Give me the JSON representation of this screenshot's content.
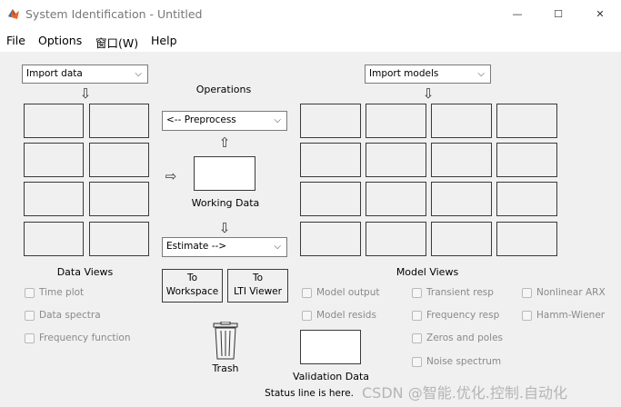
{
  "window": {
    "title": "System Identification - Untitled",
    "controls": {
      "minimize": "—",
      "maximize": "☐",
      "close": "✕"
    }
  },
  "menu": [
    "File",
    "Options",
    "窗口(W)",
    "Help"
  ],
  "data_panel": {
    "import_dropdown": "Import data",
    "section_label": "Data Views",
    "checkboxes": [
      "Time plot",
      "Data spectra",
      "Frequency function"
    ]
  },
  "operations": {
    "label": "Operations",
    "preprocess": "<-- Preprocess",
    "working_data": "Working Data",
    "estimate": "Estimate -->",
    "to_workspace_line1": "To",
    "to_workspace_line2": "Workspace",
    "to_lti_line1": "To",
    "to_lti_line2": "LTI Viewer",
    "trash": "Trash"
  },
  "model_panel": {
    "import_dropdown": "Import models",
    "section_label": "Model Views",
    "checkboxes_col1": [
      "Model output",
      "Model resids"
    ],
    "checkboxes_col2": [
      "Transient resp",
      "Frequency resp",
      "Zeros and poles",
      "Noise spectrum"
    ],
    "checkboxes_col3": [
      "Nonlinear ARX",
      "Hamm-Wiener"
    ],
    "validation_data": "Validation Data"
  },
  "status": "Status line is here.",
  "watermark": "CSDN @智能.优化.控制.自动化",
  "icons": {
    "app": "matlab-logo-icon",
    "down_arrow": "⇩",
    "up_arrow": "⇧",
    "right_arrow": "⇨",
    "chevron": "⌵"
  }
}
